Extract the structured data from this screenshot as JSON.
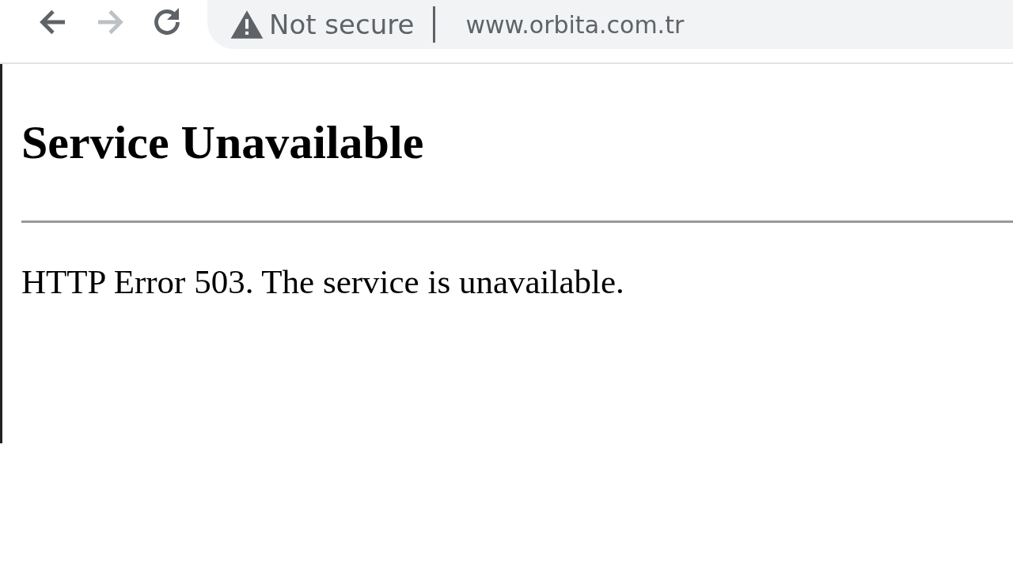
{
  "toolbar": {
    "buttons": [
      {
        "kind": "back",
        "disabled": false
      },
      {
        "kind": "forward",
        "disabled": true
      },
      {
        "kind": "reload",
        "disabled": false
      }
    ],
    "security": {
      "label": "Not secure"
    },
    "url": "www.orbita.com.tr"
  },
  "page": {
    "heading": "Service Unavailable",
    "message": "HTTP Error 503. The service is unavailable."
  }
}
